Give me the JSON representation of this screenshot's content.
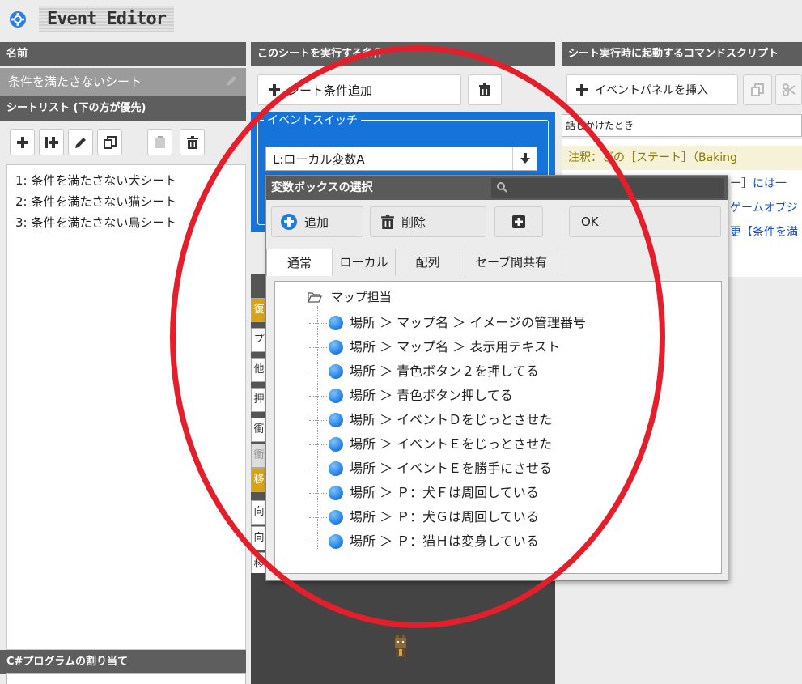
{
  "window": {
    "title": "Event Editor"
  },
  "left": {
    "name_header": "名前",
    "sheet_name": "条件を満たさないシート",
    "sheetlist_header": "シートリスト (下の方が優先)",
    "sheets": [
      "1: 条件を満たさない犬シート",
      "2: 条件を満たさない猫シート",
      "3: 条件を満たさない鳥シート"
    ],
    "csharp_header": "C#プログラムの割り当て"
  },
  "middle": {
    "header": "このシートを実行する条件",
    "add_condition_label": "シート条件追加",
    "event_switch_label": "イベントスイッチ",
    "variable_value": "L:ローカル変数A",
    "cond_rows": [
      "復",
      "プ",
      "他",
      "押",
      "衝",
      "衝",
      "移",
      "向",
      "向",
      "移"
    ]
  },
  "right": {
    "header": "シート実行時に起動するコマンドスクリプト",
    "insert_panel_label": "イベントパネルを挿入",
    "trigger_text": "話しかけたとき",
    "commands": [
      {
        "text": "注釈：どの［ステート］（Baking",
        "color": "#8a7a00"
      },
      {
        "text": "ー］には一",
        "color": "#1a4fb3"
      },
      {
        "text": "ゲームオブジ",
        "color": "#1a4fb3"
      },
      {
        "text": "更【条件を満",
        "color": "#1a4fb3"
      }
    ]
  },
  "dialog": {
    "title": "変数ボックスの選択",
    "add_label": "追加",
    "delete_label": "削除",
    "ok_label": "OK",
    "tabs": [
      "通常",
      "ローカル",
      "配列",
      "セーブ間共有"
    ],
    "active_tab": "通常",
    "tree_root": "マップ担当",
    "tree_items": [
      "場所 ＞ マップ名 ＞ イメージの管理番号",
      "場所 ＞ マップ名 ＞ 表示用テキスト",
      "場所 ＞ 青色ボタン２を押してる",
      "場所 ＞ 青色ボタン押してる",
      "場所 ＞ イベントＤをじっとさせた",
      "場所 ＞ イベントＥをじっとさせた",
      "場所 ＞ イベントＥを勝手にさせる",
      "場所 ＞ Ｐ：犬Ｆは周回している",
      "場所 ＞ Ｐ：犬Ｇは周回している",
      "場所 ＞ Ｐ：猫Ｈは変身している"
    ]
  },
  "colors": {
    "accent_blue": "#1573d9",
    "header_gray": "#5e5e5e",
    "annotation_red": "#e41e2a"
  }
}
